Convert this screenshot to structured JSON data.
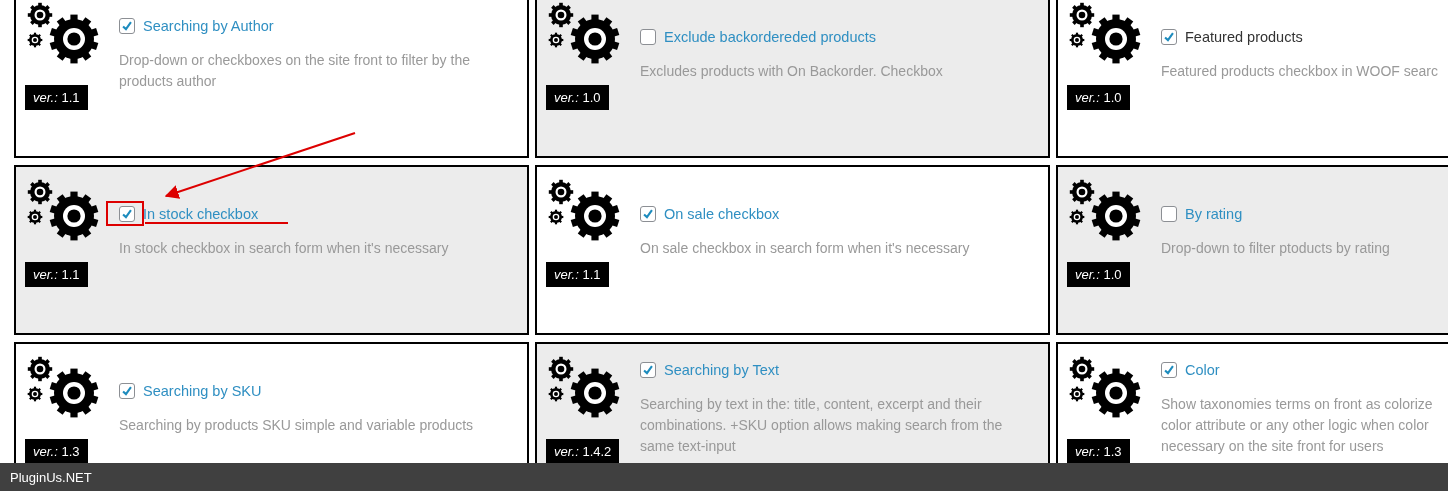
{
  "cards": [
    {
      "title": "Searching by Author",
      "link": true,
      "checked": true,
      "shaded": false,
      "description": "Drop-down or checkboxes on the site front to filter by the\nproducts author",
      "version": "*ver.:* 1.1"
    },
    {
      "title": "Exclude backordereded products",
      "link": true,
      "checked": false,
      "shaded": true,
      "description": "Excludes products with On Backorder. Checkbox",
      "version": "*ver.:* 1.0"
    },
    {
      "title": "Featured products",
      "link": false,
      "checked": true,
      "shaded": false,
      "description": "Featured products checkbox in WOOF searc",
      "version": "*ver.:* 1.0"
    },
    {
      "title": "In stock checkbox",
      "link": true,
      "checked": true,
      "shaded": true,
      "description": "In stock checkbox in search form when it's necessary",
      "version": "*ver.:* 1.1"
    },
    {
      "title": "On sale checkbox",
      "link": true,
      "checked": true,
      "shaded": false,
      "description": "On sale checkbox in search form when it's necessary",
      "version": "*ver.:* 1.1"
    },
    {
      "title": "By rating",
      "link": true,
      "checked": false,
      "shaded": true,
      "description": "Drop-down to filter ptoducts by rating",
      "version": "*ver.:* 1.0"
    },
    {
      "title": "Searching by SKU",
      "link": true,
      "checked": true,
      "shaded": false,
      "description": "Searching by products SKU simple and variable products",
      "version": "*ver.:* 1.3"
    },
    {
      "title": "Searching by Text",
      "link": true,
      "checked": true,
      "shaded": true,
      "description": "Searching by text in the: title, content, excerpt and their\ncombinations. +SKU option allows making search from the\nsame text-input",
      "version": "*ver.:* 1.4.2"
    },
    {
      "title": "Color",
      "link": true,
      "checked": true,
      "shaded": false,
      "description": "Show taxonomies terms on front as colorize\ncolor attribute or any other logic when color\nnecessary on the site front for users",
      "version": "*ver.:* 1.3"
    }
  ],
  "footer": {
    "brand": "PluginUs.NET"
  }
}
